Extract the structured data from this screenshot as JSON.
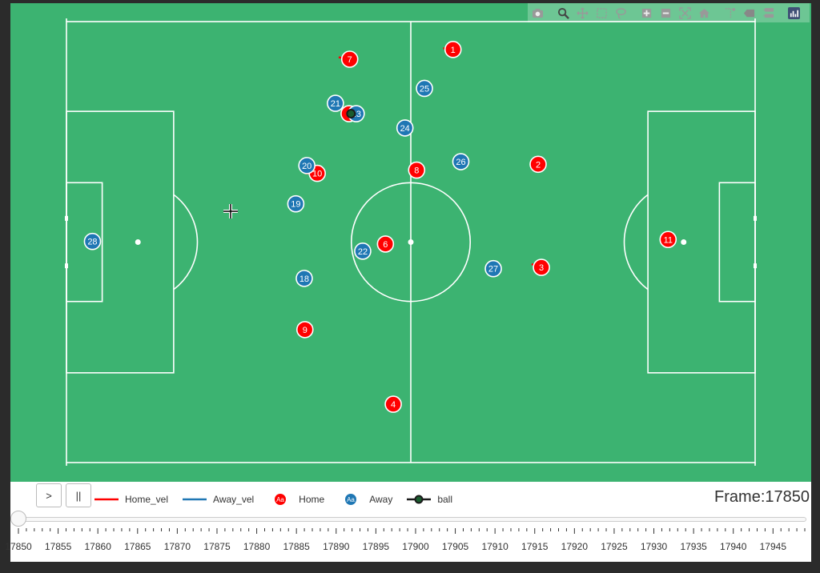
{
  "colors": {
    "pitch": "#3cb371",
    "lines": "#ffffff",
    "home": "#ff0000",
    "away": "#1f77b4",
    "ball": "#1a1a1a",
    "background": "#2b2b2b"
  },
  "modebar": {
    "buttons": [
      "camera-icon",
      "zoom-icon",
      "pan-icon",
      "box-select-icon",
      "lasso-select-icon",
      "zoom-in-icon",
      "zoom-out-icon",
      "autoscale-icon",
      "reset-axes-icon",
      "spike-lines-icon",
      "hover-closest-icon",
      "hover-compare-icon",
      "plotly-logo-icon"
    ]
  },
  "controls": {
    "play_label": ">",
    "pause_label": "||"
  },
  "legend": {
    "items": [
      {
        "label": "Home_vel",
        "symbol": "line",
        "color": "#ff0000"
      },
      {
        "label": "Away_vel",
        "symbol": "line",
        "color": "#1f77b4"
      },
      {
        "label": "Home",
        "symbol": "marker",
        "color": "#ff0000",
        "marker_text": "Aa"
      },
      {
        "label": "Away",
        "symbol": "marker",
        "color": "#1f77b4",
        "marker_text": "Aa"
      },
      {
        "label": "ball",
        "symbol": "ball",
        "color": "#1a1a1a"
      }
    ]
  },
  "frame_label": "Frame:17850",
  "slider": {
    "min": 17850,
    "max": 17949,
    "current": 17850,
    "tick_labels": [
      "17850",
      "17855",
      "17860",
      "17865",
      "17870",
      "17875",
      "17880",
      "17885",
      "17890",
      "17895",
      "17900",
      "17905",
      "17910",
      "17915",
      "17920",
      "17925",
      "17930",
      "17935",
      "17940",
      "17945"
    ]
  },
  "chart_data": {
    "type": "scatter",
    "title": "",
    "xlim": [
      -53,
      53
    ],
    "ylim": [
      -34,
      34
    ],
    "home_players": [
      {
        "number": "1",
        "x": 6.5,
        "y": 29.7,
        "vx": -1.5,
        "vy": 0.2
      },
      {
        "number": "7",
        "x": -9.4,
        "y": 28.2,
        "vx": -1.7,
        "vy": 0.3
      },
      {
        "number": "8",
        "x": 0.9,
        "y": 11.1,
        "vx": 0.0,
        "vy": 0.0
      },
      {
        "number": "10",
        "x": -14.4,
        "y": 10.6,
        "vx": -1.8,
        "vy": 0.0
      },
      {
        "number": "2",
        "x": 19.6,
        "y": 12.0,
        "vx": 0.0,
        "vy": 0.0
      },
      {
        "number": "6",
        "x": -3.9,
        "y": -0.3,
        "vx": 0.0,
        "vy": 0.0
      },
      {
        "number": "9",
        "x": -16.3,
        "y": -13.5,
        "vx": 0.0,
        "vy": 0.0
      },
      {
        "number": "4",
        "x": -2.7,
        "y": -25.0,
        "vx": 0.0,
        "vy": 0.0
      },
      {
        "number": "11",
        "x": 39.6,
        "y": 0.4,
        "vx": 0.0,
        "vy": 0.0
      },
      {
        "number": "3",
        "x": 20.1,
        "y": -3.9,
        "vx": -1.5,
        "vy": 0.5
      },
      {
        "number": "5",
        "x": -9.5,
        "y": 19.8,
        "vx": 0.0,
        "vy": 0.0
      }
    ],
    "away_players": [
      {
        "number": "28",
        "x": -49.0,
        "y": 0.1,
        "vx": 0.0,
        "vy": 0.0
      },
      {
        "number": "21",
        "x": -11.6,
        "y": 21.4,
        "vx": 0.0,
        "vy": 0.0
      },
      {
        "number": "23",
        "x": -8.4,
        "y": 19.8,
        "vx": 0.0,
        "vy": 0.0
      },
      {
        "number": "25",
        "x": 2.1,
        "y": 23.7,
        "vx": 0.0,
        "vy": 0.0
      },
      {
        "number": "24",
        "x": -0.9,
        "y": 17.6,
        "vx": 0.0,
        "vy": 0.0
      },
      {
        "number": "20",
        "x": -16.0,
        "y": 11.8,
        "vx": 0.0,
        "vy": 0.0
      },
      {
        "number": "26",
        "x": 7.7,
        "y": 12.4,
        "vx": 0.0,
        "vy": 0.0
      },
      {
        "number": "19",
        "x": -17.7,
        "y": 5.9,
        "vx": -0.7,
        "vy": 0.5
      },
      {
        "number": "22",
        "x": -7.4,
        "y": -1.4,
        "vx": -1.0,
        "vy": 0.3
      },
      {
        "number": "18",
        "x": -16.4,
        "y": -5.6,
        "vx": 0.0,
        "vy": 0.0
      },
      {
        "number": "27",
        "x": 12.7,
        "y": -4.1,
        "vx": 0.0,
        "vy": 0.0
      }
    ],
    "ball": {
      "x": -9.2,
      "y": 19.8
    }
  }
}
